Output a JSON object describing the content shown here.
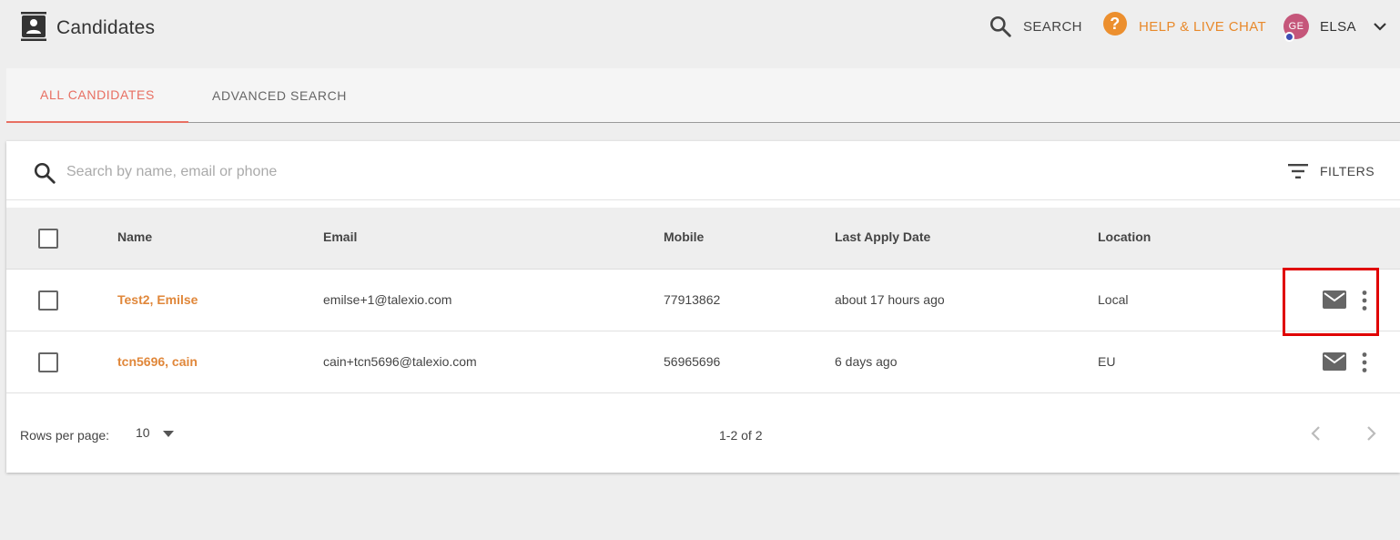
{
  "header": {
    "title": "Candidates",
    "page_icon": "contacts-icon",
    "search_label": "SEARCH",
    "help_label": "HELP & LIVE CHAT",
    "user": {
      "initials": "GE",
      "name": "ELSA"
    }
  },
  "tabs": [
    {
      "label": "ALL CANDIDATES",
      "active": true
    },
    {
      "label": "ADVANCED SEARCH",
      "active": false
    }
  ],
  "search": {
    "placeholder": "Search by name, email or phone",
    "value": "",
    "filters_label": "FILTERS"
  },
  "table": {
    "columns": [
      "Name",
      "Email",
      "Mobile",
      "Last Apply Date",
      "Location"
    ],
    "rows": [
      {
        "name": "Test2, Emilse",
        "email": "emilse+1@talexio.com",
        "mobile": "77913862",
        "last_apply": "about 17 hours ago",
        "location": "Local"
      },
      {
        "name": "tcn5696, cain",
        "email": "cain+tcn5696@talexio.com",
        "mobile": "56965696",
        "last_apply": "6 days ago",
        "location": "EU"
      }
    ]
  },
  "pagination": {
    "rows_per_page_label": "Rows per page:",
    "rows_per_page": "10",
    "range": "1-2 of 2"
  },
  "colors": {
    "accent": "#e86f62",
    "name_link": "#e0873a",
    "help": "#ec8f2e",
    "avatar": "#c5567a",
    "highlight_box": "#e00000"
  }
}
